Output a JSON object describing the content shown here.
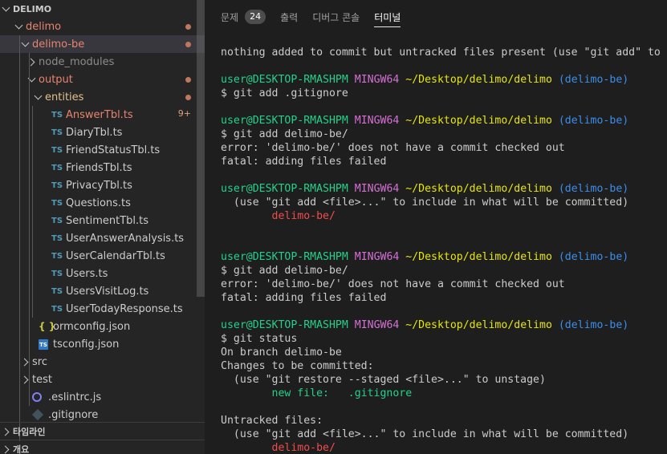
{
  "explorer": {
    "root": "DELIMO",
    "rows": [
      {
        "label": "delimo",
        "indent": 1,
        "chev": "down",
        "icon": "",
        "cls": "mod-red",
        "dot": true
      },
      {
        "label": "delimo-be",
        "indent": 2,
        "chev": "down",
        "icon": "",
        "cls": "mod-red",
        "dot": true,
        "selected": true
      },
      {
        "label": "node_modules",
        "indent": 3,
        "chev": "right",
        "icon": "",
        "cls": "dim"
      },
      {
        "label": "output",
        "indent": 3,
        "chev": "down",
        "icon": "",
        "cls": "mod-red",
        "dot": true
      },
      {
        "label": "entities",
        "indent": 4,
        "chev": "down",
        "icon": "",
        "cls": "modified",
        "dot": true
      },
      {
        "label": "AnswerTbl.ts",
        "indent": 5,
        "chev": "",
        "icon": "TS",
        "cls": "mod-red",
        "badge": "9+"
      },
      {
        "label": "DiaryTbl.ts",
        "indent": 5,
        "chev": "",
        "icon": "TS",
        "cls": ""
      },
      {
        "label": "FriendStatusTbl.ts",
        "indent": 5,
        "chev": "",
        "icon": "TS",
        "cls": ""
      },
      {
        "label": "FriendsTbl.ts",
        "indent": 5,
        "chev": "",
        "icon": "TS",
        "cls": ""
      },
      {
        "label": "PrivacyTbl.ts",
        "indent": 5,
        "chev": "",
        "icon": "TS",
        "cls": ""
      },
      {
        "label": "Questions.ts",
        "indent": 5,
        "chev": "",
        "icon": "TS",
        "cls": ""
      },
      {
        "label": "SentimentTbl.ts",
        "indent": 5,
        "chev": "",
        "icon": "TS",
        "cls": ""
      },
      {
        "label": "UserAnswerAnalysis.ts",
        "indent": 5,
        "chev": "",
        "icon": "TS",
        "cls": ""
      },
      {
        "label": "UserCalendarTbl.ts",
        "indent": 5,
        "chev": "",
        "icon": "TS",
        "cls": ""
      },
      {
        "label": "Users.ts",
        "indent": 5,
        "chev": "",
        "icon": "TS",
        "cls": ""
      },
      {
        "label": "UsersVisitLog.ts",
        "indent": 5,
        "chev": "",
        "icon": "TS",
        "cls": ""
      },
      {
        "label": "UserTodayResponse.ts",
        "indent": 5,
        "chev": "",
        "icon": "TS",
        "cls": ""
      },
      {
        "label": "ormconfig.json",
        "indent": 3,
        "chev": "",
        "icon": "{}",
        "cls": ""
      },
      {
        "label": "tsconfig.json",
        "indent": 3,
        "chev": "",
        "icon": "tsconf",
        "cls": ""
      },
      {
        "label": "src",
        "indent": 2,
        "chev": "right",
        "icon": "",
        "cls": ""
      },
      {
        "label": "test",
        "indent": 2,
        "chev": "right",
        "icon": "",
        "cls": ""
      },
      {
        "label": ".eslintrc.js",
        "indent": 2,
        "chev": "",
        "icon": "eslint",
        "cls": ""
      },
      {
        "label": ".gitignore",
        "indent": 2,
        "chev": "",
        "icon": "git",
        "cls": ""
      }
    ],
    "sections": [
      {
        "label": "타임라인"
      },
      {
        "label": "개요"
      }
    ]
  },
  "panel": {
    "tabs": [
      {
        "label": "문제",
        "badge": "24",
        "active": false
      },
      {
        "label": "출력",
        "active": false
      },
      {
        "label": "디버그 콘솔",
        "active": false
      },
      {
        "label": "터미널",
        "active": true
      }
    ]
  },
  "terminal": {
    "lines": [
      [
        {
          "t": "nothing added to commit but untracked files present (use \"git add\" to track)",
          "c": ""
        }
      ],
      [],
      [
        {
          "t": "user@DESKTOP-RMASHPM",
          "c": "c-user"
        },
        {
          "t": " ",
          "c": ""
        },
        {
          "t": "MINGW64",
          "c": "c-mg"
        },
        {
          "t": " ",
          "c": ""
        },
        {
          "t": "~/Desktop/delimo/delimo",
          "c": "c-path"
        },
        {
          "t": " ",
          "c": ""
        },
        {
          "t": "(delimo-be)",
          "c": "c-branch"
        }
      ],
      [
        {
          "t": "$ git add .gitignore",
          "c": ""
        }
      ],
      [],
      [
        {
          "t": "user@DESKTOP-RMASHPM",
          "c": "c-user"
        },
        {
          "t": " ",
          "c": ""
        },
        {
          "t": "MINGW64",
          "c": "c-mg"
        },
        {
          "t": " ",
          "c": ""
        },
        {
          "t": "~/Desktop/delimo/delimo",
          "c": "c-path"
        },
        {
          "t": " ",
          "c": ""
        },
        {
          "t": "(delimo-be)",
          "c": "c-branch"
        }
      ],
      [
        {
          "t": "$ git add delimo-be/",
          "c": ""
        }
      ],
      [
        {
          "t": "error: 'delimo-be/' does not have a commit checked out",
          "c": ""
        }
      ],
      [
        {
          "t": "fatal: adding files failed",
          "c": ""
        }
      ],
      [],
      [
        {
          "t": "user@DESKTOP-RMASHPM",
          "c": "c-user"
        },
        {
          "t": " ",
          "c": ""
        },
        {
          "t": "MINGW64",
          "c": "c-mg"
        },
        {
          "t": " ",
          "c": ""
        },
        {
          "t": "~/Desktop/delimo/delimo",
          "c": "c-path"
        },
        {
          "t": " ",
          "c": ""
        },
        {
          "t": "(delimo-be)",
          "c": "c-branch"
        }
      ],
      [
        {
          "t": "  (use \"git add <file>...\" to include in what will be committed)",
          "c": ""
        }
      ],
      [
        {
          "t": "        delimo-be/",
          "c": "c-red"
        }
      ],
      [],
      [],
      [
        {
          "t": "user@DESKTOP-RMASHPM",
          "c": "c-user"
        },
        {
          "t": " ",
          "c": ""
        },
        {
          "t": "MINGW64",
          "c": "c-mg"
        },
        {
          "t": " ",
          "c": ""
        },
        {
          "t": "~/Desktop/delimo/delimo",
          "c": "c-path"
        },
        {
          "t": " ",
          "c": ""
        },
        {
          "t": "(delimo-be)",
          "c": "c-branch"
        }
      ],
      [
        {
          "t": "$ git add delimo-be/",
          "c": ""
        }
      ],
      [
        {
          "t": "error: 'delimo-be/' does not have a commit checked out",
          "c": ""
        }
      ],
      [
        {
          "t": "fatal: adding files failed",
          "c": ""
        }
      ],
      [],
      [
        {
          "t": "user@DESKTOP-RMASHPM",
          "c": "c-user"
        },
        {
          "t": " ",
          "c": ""
        },
        {
          "t": "MINGW64",
          "c": "c-mg"
        },
        {
          "t": " ",
          "c": ""
        },
        {
          "t": "~/Desktop/delimo/delimo",
          "c": "c-path"
        },
        {
          "t": " ",
          "c": ""
        },
        {
          "t": "(delimo-be)",
          "c": "c-branch"
        }
      ],
      [
        {
          "t": "$ git status",
          "c": ""
        }
      ],
      [
        {
          "t": "On branch delimo-be",
          "c": ""
        }
      ],
      [
        {
          "t": "Changes to be committed:",
          "c": ""
        }
      ],
      [
        {
          "t": "  (use \"git restore --staged <file>...\" to unstage)",
          "c": ""
        }
      ],
      [
        {
          "t": "        new file:   .gitignore",
          "c": "c-green"
        }
      ],
      [],
      [
        {
          "t": "Untracked files:",
          "c": ""
        }
      ],
      [
        {
          "t": "  (use \"git add <file>...\" to include in what will be committed)",
          "c": ""
        }
      ],
      [
        {
          "t": "        delimo-be/",
          "c": "c-red"
        }
      ]
    ]
  },
  "colors": {
    "prompt_user": "#23d18b",
    "prompt_mingw": "#d670d6",
    "prompt_path": "#e5e510",
    "prompt_branch": "#3b8eea",
    "untracked_red": "#f14c4c",
    "staged_green": "#23d18b"
  }
}
